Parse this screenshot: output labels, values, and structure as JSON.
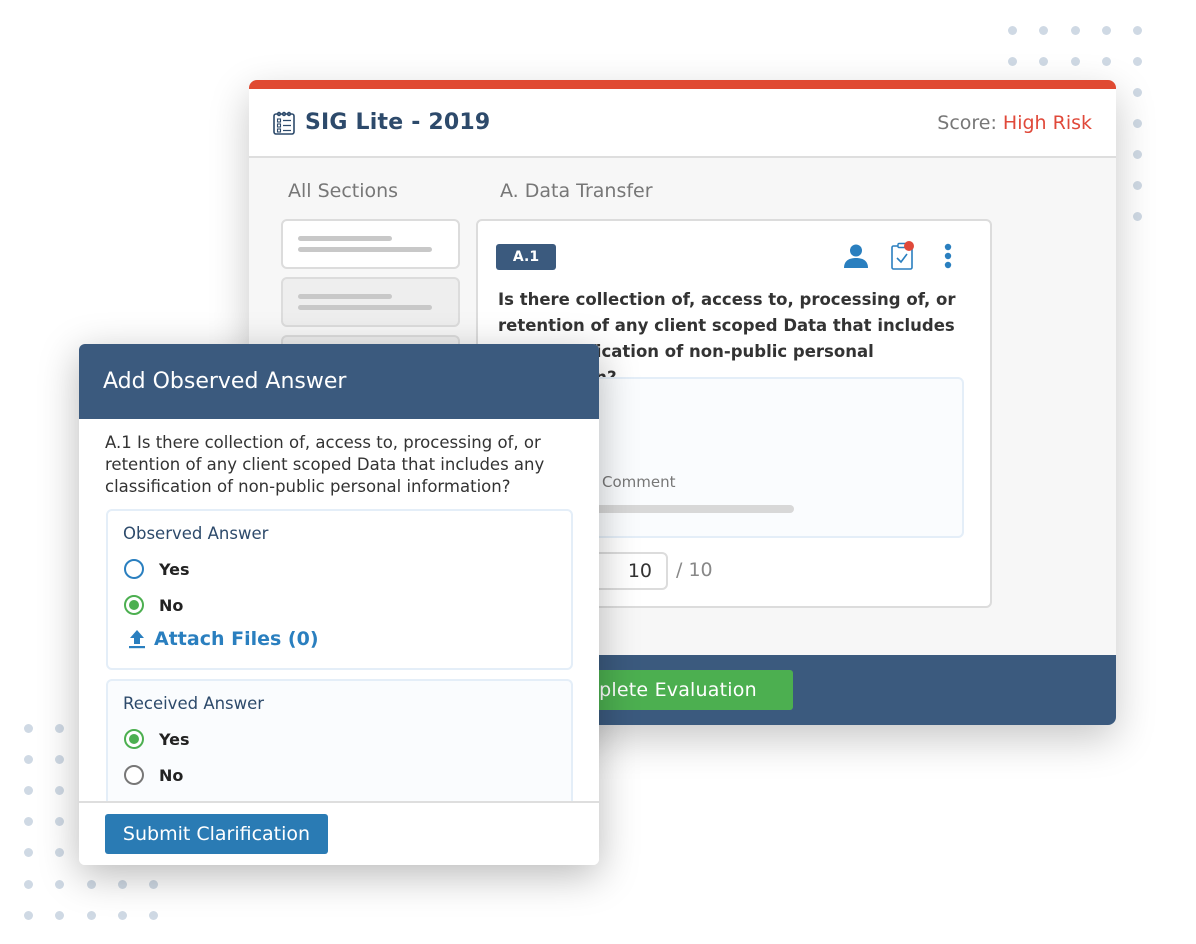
{
  "main_window": {
    "title": "SIG Lite - 2019",
    "score_label": "Score:",
    "score_value": "High Risk",
    "columns": {
      "sections": "All Sections",
      "section_title": "A. Data Transfer"
    },
    "question": {
      "badge": "A.1",
      "text": "Is there collection of, access to, processing of, or retention of any client scoped Data that includes any classification of non-public personal information?",
      "comment_label": "Comment",
      "score_input": "10",
      "score_max": "/ 10"
    },
    "footer": {
      "complete_button": "Complete Evaluation"
    }
  },
  "modal": {
    "title": "Add Observed Answer",
    "question": "A.1 Is there collection of, access to, processing of, or retention of any client scoped Data that includes any classification of non-public personal information?",
    "observed": {
      "label": "Observed Answer",
      "options": [
        "Yes",
        "No"
      ],
      "selected": "No",
      "attach_label": "Attach Files (0)"
    },
    "received": {
      "label": "Received Answer",
      "options": [
        "Yes",
        "No"
      ],
      "selected": "Yes"
    },
    "submit_button": "Submit Clarification"
  },
  "colors": {
    "accent_red": "#e04a32",
    "navy": "#3b5a7e",
    "green": "#4caf50",
    "link_blue": "#2a7fbf"
  }
}
